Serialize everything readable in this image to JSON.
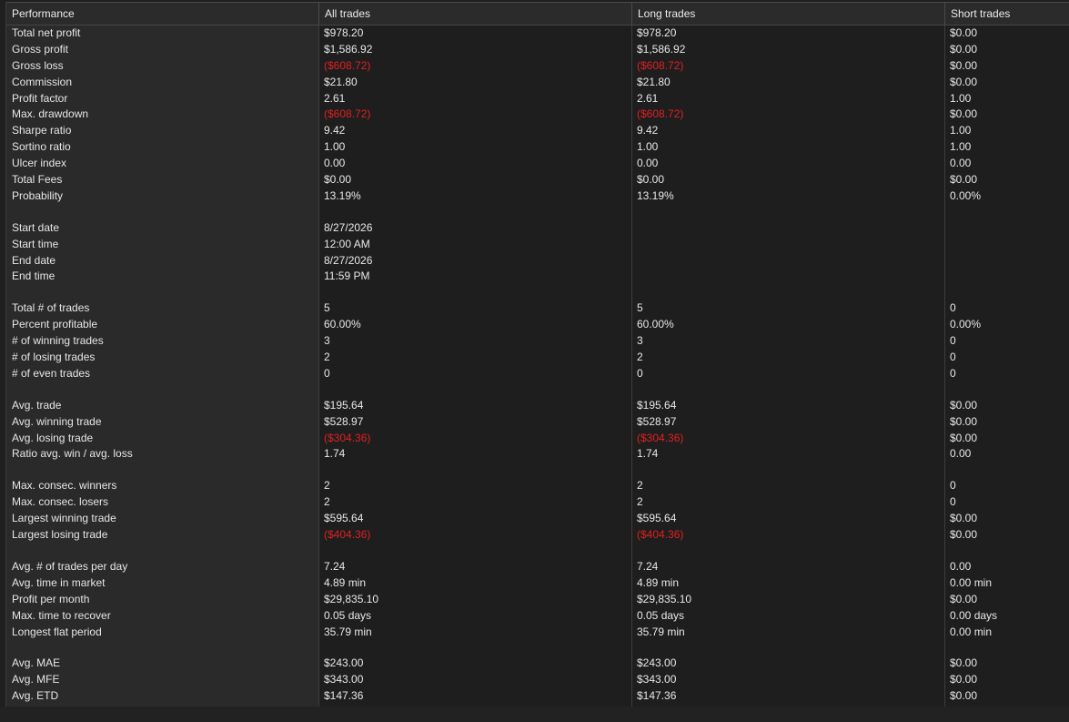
{
  "header": {
    "col0": "Performance",
    "col1": "All trades",
    "col2": "Long trades",
    "col3": "Short trades"
  },
  "rows": [
    {
      "label": "Total net profit",
      "all": "$978.20",
      "long": "$978.20",
      "short": "$0.00"
    },
    {
      "label": "Gross profit",
      "all": "$1,586.92",
      "long": "$1,586.92",
      "short": "$0.00"
    },
    {
      "label": "Gross loss",
      "all": "($608.72)",
      "long": "($608.72)",
      "short": "$0.00"
    },
    {
      "label": "Commission",
      "all": "$21.80",
      "long": "$21.80",
      "short": "$0.00"
    },
    {
      "label": "Profit factor",
      "all": "2.61",
      "long": "2.61",
      "short": "1.00"
    },
    {
      "label": "Max. drawdown",
      "all": "($608.72)",
      "long": "($608.72)",
      "short": "$0.00"
    },
    {
      "label": "Sharpe ratio",
      "all": "9.42",
      "long": "9.42",
      "short": "1.00"
    },
    {
      "label": "Sortino ratio",
      "all": "1.00",
      "long": "1.00",
      "short": "1.00"
    },
    {
      "label": "Ulcer index",
      "all": "0.00",
      "long": "0.00",
      "short": "0.00"
    },
    {
      "label": "Total Fees",
      "all": "$0.00",
      "long": "$0.00",
      "short": "$0.00"
    },
    {
      "label": "Probability",
      "all": "13.19%",
      "long": "13.19%",
      "short": "0.00%"
    },
    {
      "gap": true
    },
    {
      "label": "Start date",
      "all": "8/27/2026",
      "long": "",
      "short": ""
    },
    {
      "label": "Start time",
      "all": "12:00 AM",
      "long": "",
      "short": ""
    },
    {
      "label": "End date",
      "all": "8/27/2026",
      "long": "",
      "short": ""
    },
    {
      "label": "End time",
      "all": "11:59 PM",
      "long": "",
      "short": ""
    },
    {
      "gap": true
    },
    {
      "label": "Total # of trades",
      "all": "5",
      "long": "5",
      "short": "0"
    },
    {
      "label": "Percent profitable",
      "all": "60.00%",
      "long": "60.00%",
      "short": "0.00%"
    },
    {
      "label": "# of winning trades",
      "all": "3",
      "long": "3",
      "short": "0"
    },
    {
      "label": "# of losing trades",
      "all": "2",
      "long": "2",
      "short": "0"
    },
    {
      "label": "# of even trades",
      "all": "0",
      "long": "0",
      "short": "0"
    },
    {
      "gap": true
    },
    {
      "label": "Avg. trade",
      "all": "$195.64",
      "long": "$195.64",
      "short": "$0.00"
    },
    {
      "label": "Avg. winning trade",
      "all": "$528.97",
      "long": "$528.97",
      "short": "$0.00"
    },
    {
      "label": "Avg. losing trade",
      "all": "($304.36)",
      "long": "($304.36)",
      "short": "$0.00"
    },
    {
      "label": "Ratio avg. win / avg. loss",
      "all": "1.74",
      "long": "1.74",
      "short": "0.00"
    },
    {
      "gap": true
    },
    {
      "label": "Max. consec. winners",
      "all": "2",
      "long": "2",
      "short": "0"
    },
    {
      "label": "Max. consec. losers",
      "all": "2",
      "long": "2",
      "short": "0"
    },
    {
      "label": "Largest winning trade",
      "all": "$595.64",
      "long": "$595.64",
      "short": "$0.00"
    },
    {
      "label": "Largest losing trade",
      "all": "($404.36)",
      "long": "($404.36)",
      "short": "$0.00"
    },
    {
      "gap": true
    },
    {
      "label": "Avg. # of trades per day",
      "all": "7.24",
      "long": "7.24",
      "short": "0.00"
    },
    {
      "label": "Avg. time in market",
      "all": "4.89 min",
      "long": "4.89 min",
      "short": "0.00 min"
    },
    {
      "label": "Profit per month",
      "all": "$29,835.10",
      "long": "$29,835.10",
      "short": "$0.00"
    },
    {
      "label": "Max. time to recover",
      "all": "0.05 days",
      "long": "0.05 days",
      "short": "0.00 days"
    },
    {
      "label": "Longest flat period",
      "all": "35.79 min",
      "long": "35.79 min",
      "short": "0.00 min"
    },
    {
      "gap": true
    },
    {
      "label": "Avg. MAE",
      "all": "$243.00",
      "long": "$243.00",
      "short": "$0.00"
    },
    {
      "label": "Avg. MFE",
      "all": "$343.00",
      "long": "$343.00",
      "short": "$0.00"
    },
    {
      "label": "Avg. ETD",
      "all": "$147.36",
      "long": "$147.36",
      "short": "$0.00"
    }
  ],
  "colors": {
    "negative": "#e02020",
    "text": "#e8e8e8",
    "label_column_bg": "#2a2a2a",
    "value_column_bg": "#1e1e1e"
  }
}
